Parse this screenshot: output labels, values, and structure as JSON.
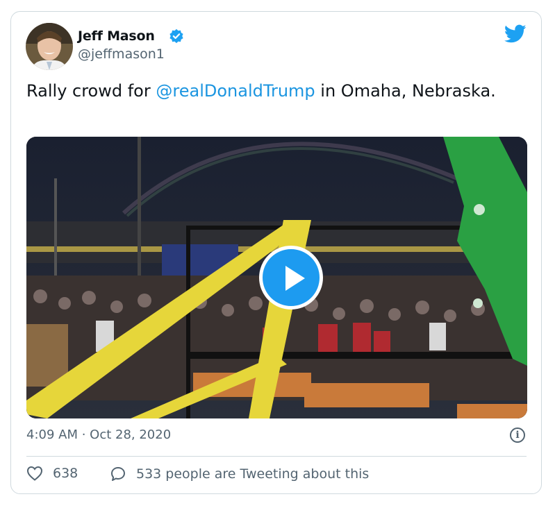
{
  "author": {
    "name": "Jeff Mason",
    "handle": "@jeffmason1",
    "avatar_icon": "person-avatar",
    "verified_icon": "verified-badge-icon"
  },
  "brand": {
    "icon": "twitter-bird-icon",
    "color": "#1da1f2"
  },
  "tweet": {
    "text_before": "Rally crowd for ",
    "mention": "@realDonaldTrump",
    "text_after": " in Omaha, Nebraska.",
    "mention_color": "#1b95e0"
  },
  "media": {
    "type": "video",
    "play_icon": "play-icon",
    "accent_color": "#1d9bf0"
  },
  "meta": {
    "timestamp": "4:09 AM · Oct 28, 2020",
    "info_icon": "info-icon",
    "info_glyph": "i"
  },
  "actions": {
    "likes": "638",
    "like_icon": "heart-icon",
    "reply_icon": "speech-bubble-icon",
    "conversation_label": "533 people are Tweeting about this"
  }
}
